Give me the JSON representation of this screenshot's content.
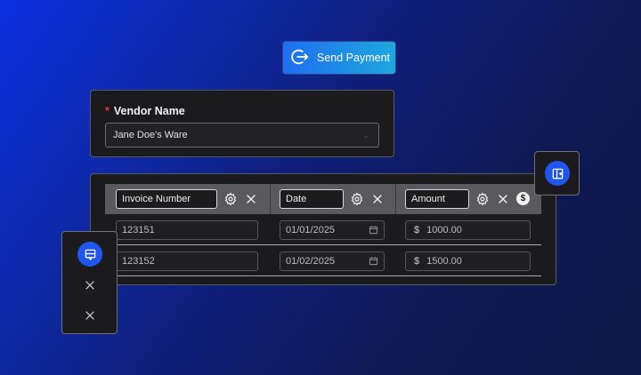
{
  "send_button": {
    "label": "Send Payment",
    "icon": "send-icon"
  },
  "vendor": {
    "label": "Vendor Name",
    "required_mark": "*",
    "value": "Jane Doe's Ware"
  },
  "table": {
    "columns": [
      {
        "label": "Invoice Number"
      },
      {
        "label": "Date"
      },
      {
        "label": "Amount"
      }
    ],
    "currency_symbol": "$",
    "rows": [
      {
        "invoice": "123151",
        "date": "01/01/2025",
        "amount": "1000.00"
      },
      {
        "invoice": "123152",
        "date": "01/02/2025",
        "amount": "1500.00"
      }
    ]
  },
  "colors": {
    "accent": "#1f56f0",
    "required": "#e23a3a",
    "send_gradient_start": "#1f6ff0",
    "send_gradient_end": "#1ea7dd"
  }
}
